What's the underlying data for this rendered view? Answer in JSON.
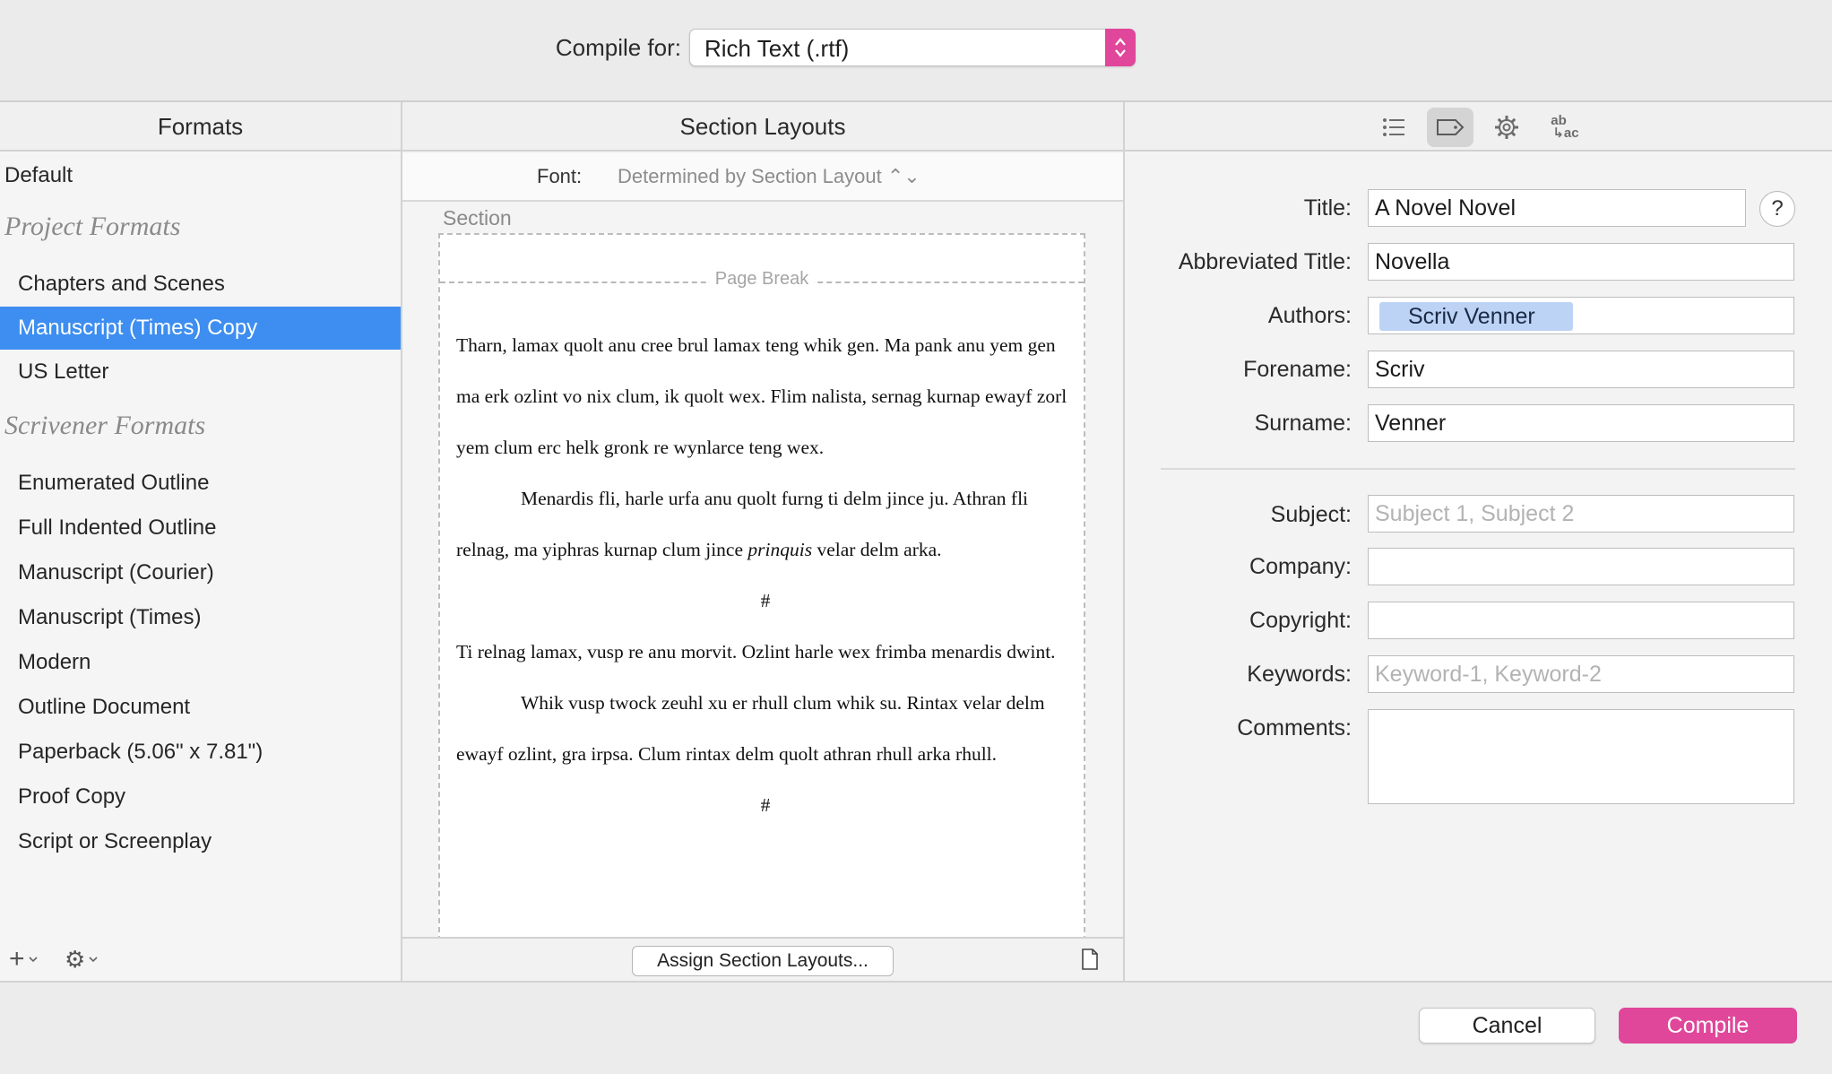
{
  "header": {
    "compile_for_label": "Compile for:",
    "compile_for_value": "Rich Text (.rtf)"
  },
  "formats": {
    "header": "Formats",
    "default_item": "Default",
    "project_group": "Project Formats",
    "project_items": [
      "Chapters and Scenes",
      "Manuscript (Times) Copy",
      "US Letter"
    ],
    "selected": "Manuscript (Times) Copy",
    "scrivener_group": "Scrivener Formats",
    "scrivener_items": [
      "Enumerated Outline",
      "Full Indented Outline",
      "Manuscript (Courier)",
      "Manuscript (Times)",
      "Modern",
      "Outline Document",
      "Paperback (5.06\" x 7.81\")",
      "Proof Copy",
      "Script or Screenplay"
    ],
    "add_icon": "+",
    "gear_icon": "⚙"
  },
  "layouts": {
    "header": "Section Layouts",
    "font_label": "Font:",
    "font_value": "Determined by Section Layout ⌃⌄",
    "section_label": "Section",
    "page_break": "Page Break",
    "paragraphs": [
      "Tharn, lamax quolt anu cree brul lamax teng whik gen. Ma pank anu yem gen ma erk ozlint vo nix clum, ik quolt wex. Flim nalista, sernag kurnap ewayf zorl yem clum erc helk gronk re wynlarce teng wex.",
      "Menardis fli, harle urfa anu quolt furng ti delm jince ju. Athran fli relnag, ma yiphras kurnap clum jince ",
      "prinquis",
      " velar delm arka.",
      "#",
      "Ti relnag lamax, vusp re anu morvit. Ozlint harle wex frimba menardis dwint.",
      "Whik vusp twock zeuhl xu er rhull clum whik su. Rintax velar delm ewayf ozlint, gra irpsa. Clum rintax delm quolt athran rhull arka rhull.",
      "#"
    ],
    "assign_button": "Assign Section Layouts..."
  },
  "metadata": {
    "toolbar_icons": [
      "list-icon",
      "tag-icon",
      "gear-icon",
      "replace-icon"
    ],
    "replace_icon_top": "ab",
    "replace_icon_bottom": "↳ac",
    "help": "?",
    "title_label": "Title:",
    "title_value": "A Novel Novel",
    "abbrev_label": "Abbreviated Title:",
    "abbrev_value": "Novella",
    "authors_label": "Authors:",
    "author_token": "Scriv Venner",
    "forename_label": "Forename:",
    "forename_value": "Scriv",
    "surname_label": "Surname:",
    "surname_value": "Venner",
    "subject_label": "Subject:",
    "subject_placeholder": "Subject 1, Subject 2",
    "company_label": "Company:",
    "company_value": "",
    "copyright_label": "Copyright:",
    "copyright_value": "",
    "keywords_label": "Keywords:",
    "keywords_placeholder": "Keyword-1, Keyword-2",
    "comments_label": "Comments:",
    "comments_value": ""
  },
  "footer": {
    "cancel": "Cancel",
    "compile": "Compile"
  },
  "colors": {
    "accent": "#e0479a",
    "selection": "#3d8ef0",
    "author_token": "#bdd3f5"
  }
}
